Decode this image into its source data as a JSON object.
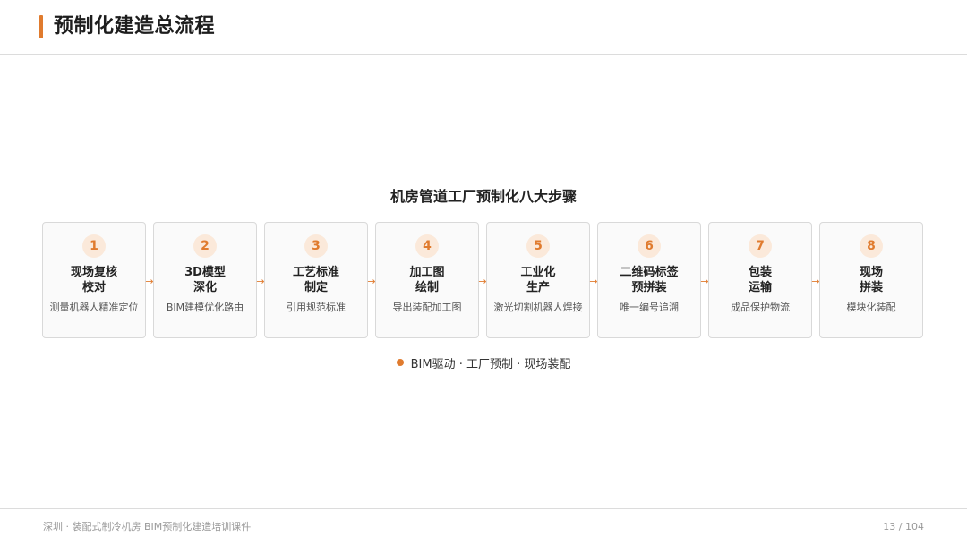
{
  "header": {
    "title": "预制化建造总流程",
    "accent_color": "#e07b2e"
  },
  "diagram": {
    "title": "机房管道工厂预制化八大步骤",
    "arrow_glyph": "→",
    "steps": [
      {
        "num": "1",
        "title_line1": "现场复核",
        "title_line2": "校对",
        "desc": "测量机器人精准定位"
      },
      {
        "num": "2",
        "title_line1": "3D模型",
        "title_line2": "深化",
        "desc": "BIM建模优化路由"
      },
      {
        "num": "3",
        "title_line1": "工艺标准",
        "title_line2": "制定",
        "desc": "引用规范标准"
      },
      {
        "num": "4",
        "title_line1": "加工图",
        "title_line2": "绘制",
        "desc": "导出装配加工图"
      },
      {
        "num": "5",
        "title_line1": "工业化",
        "title_line2": "生产",
        "desc": "激光切割机器人焊接"
      },
      {
        "num": "6",
        "title_line1": "二维码标签",
        "title_line2": "预拼装",
        "desc": "唯一编号追溯"
      },
      {
        "num": "7",
        "title_line1": "包装",
        "title_line2": "运输",
        "desc": "成品保护物流"
      },
      {
        "num": "8",
        "title_line1": "现场",
        "title_line2": "拼装",
        "desc": "模块化装配"
      }
    ],
    "tagline": "BIM驱动 · 工厂预制 · 现场装配"
  },
  "footer": {
    "left": "深圳 · 装配式制冷机房 BIM预制化建造培训课件",
    "page": "13 / 104"
  }
}
